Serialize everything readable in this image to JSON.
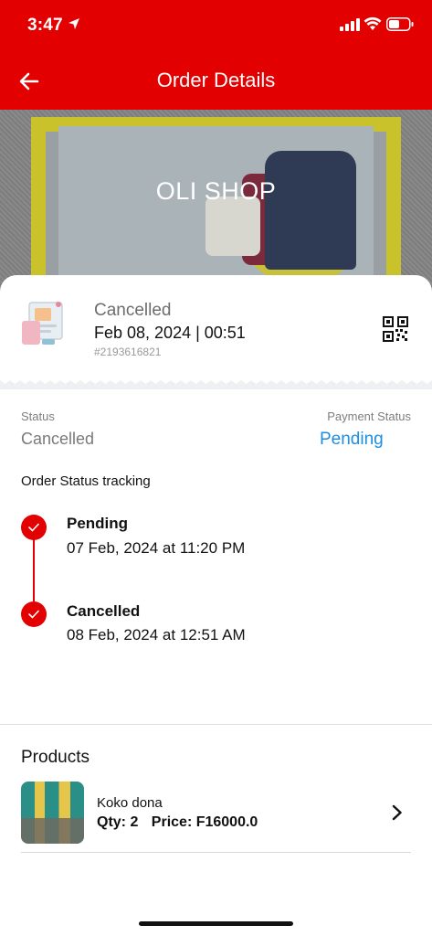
{
  "status_bar": {
    "time": "3:47"
  },
  "app_bar": {
    "title": "Order Details"
  },
  "banner": {
    "shop_name": "OLI SHOP"
  },
  "order": {
    "state": "Cancelled",
    "datetime": "Feb 08, 2024 | 00:51",
    "id": "#2193616821"
  },
  "summary": {
    "status_label": "Status",
    "status_value": "Cancelled",
    "payment_label": "Payment Status",
    "payment_value": "Pending"
  },
  "tracking": {
    "title": "Order Status tracking",
    "steps": [
      {
        "title": "Pending",
        "date": "07 Feb, 2024 at 11:20 PM"
      },
      {
        "title": "Cancelled",
        "date": "08 Feb, 2024 at 12:51 AM"
      }
    ]
  },
  "products": {
    "title": "Products",
    "items": [
      {
        "name": "Koko dona",
        "qty": "Qty: 2",
        "price": "Price: F16000.0"
      }
    ]
  },
  "colors": {
    "brand": "#e30000",
    "link": "#1e8ee0",
    "muted": "#7d7d7d"
  },
  "icons": [
    "location-arrow-icon",
    "signal-icon",
    "wifi-icon",
    "battery-icon",
    "back-arrow-icon",
    "order-illustration-icon",
    "qr-code-icon",
    "check-icon",
    "chevron-right-icon"
  ]
}
